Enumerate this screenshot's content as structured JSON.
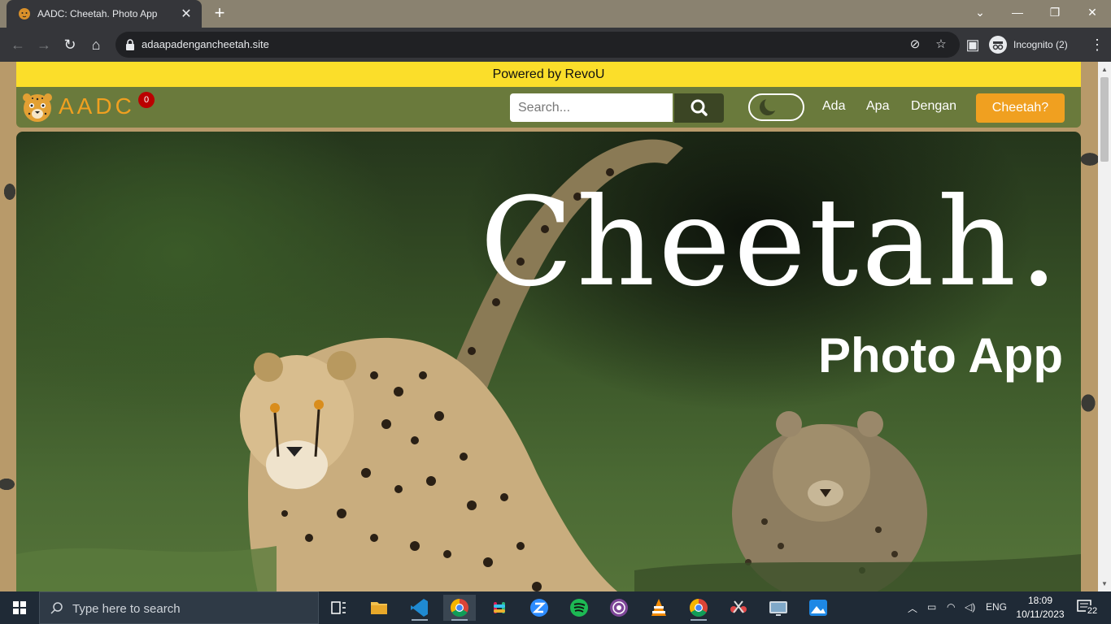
{
  "browser": {
    "tab": {
      "title": "AADC: Cheetah. Photo App",
      "favicon": "cheetah-favicon"
    },
    "new_tab_label": "+",
    "url": "adaapadengancheetah.site",
    "incognito_label": "Incognito (2)",
    "window_controls": [
      "chevron-down-icon",
      "minimize-icon",
      "restore-icon",
      "close-icon"
    ]
  },
  "site": {
    "banner": "Powered by RevoU",
    "logo": "AADC",
    "cart_count": "0",
    "search_placeholder": "Search...",
    "nav": [
      "Ada",
      "Apa",
      "Dengan"
    ],
    "cta": "Cheetah?",
    "hero_title": "Cheetah.",
    "hero_subtitle": "Photo App",
    "colors": {
      "banner": "#fbde2a",
      "navbar": "#6a7a3c",
      "accent": "#f0a020",
      "search_button": "#3b4524"
    }
  },
  "taskbar": {
    "search_text": "Type here to search",
    "language": "ENG",
    "time": "18:09",
    "date": "10/11/2023",
    "notification_count": "22",
    "apps": [
      "task-view-icon",
      "file-explorer-icon",
      "vscode-icon",
      "chrome-icon",
      "slack-icon",
      "zoom-icon",
      "spotify-icon",
      "tor-icon",
      "vlc-icon",
      "chrome-alt-icon",
      "snipping-icon",
      "screen-icon",
      "photos-icon"
    ]
  }
}
